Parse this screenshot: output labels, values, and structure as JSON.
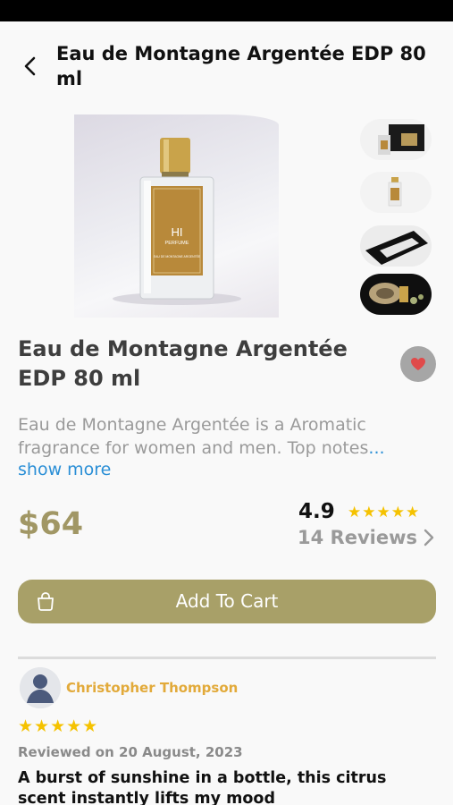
{
  "header": {
    "title": "Eau de Montagne Argentée EDP 80 ml"
  },
  "product": {
    "title": "Eau de Montagne Argentée EDP 80 ml",
    "label_brand_top": "HI",
    "label_brand_bottom": "PERFUME",
    "label_name": "EAU DE MONTAGNE ARGENTÉE",
    "description": "Eau de Montagne Argentée is a Aromatic fragrance for women and men. Top notes",
    "ellipsis": "...",
    "show_more": "show more",
    "price": "$64"
  },
  "rating": {
    "value": "4.9",
    "stars": "★★★★★",
    "reviews_label": "14 Reviews"
  },
  "cart": {
    "label": "Add To Cart"
  },
  "review": {
    "name": "Christopher Thompson",
    "stars": "★★★★★",
    "date": "Reviewed on 20 August, 2023",
    "title": "A burst of sunshine in a bottle, this citrus scent instantly lifts my mood"
  },
  "colors": {
    "accent": "#a8a068",
    "price": "#a19765",
    "star": "#f5c200",
    "link": "#2b8fd6",
    "reviewer": "#e2aa3a",
    "favorite_heart": "#e04a4a"
  },
  "icons": {
    "back": "chevron-left-icon",
    "favorite": "heart-icon",
    "cart": "shopping-bag-icon",
    "reviews_arrow": "chevron-right-icon",
    "avatar": "user-avatar-icon"
  }
}
